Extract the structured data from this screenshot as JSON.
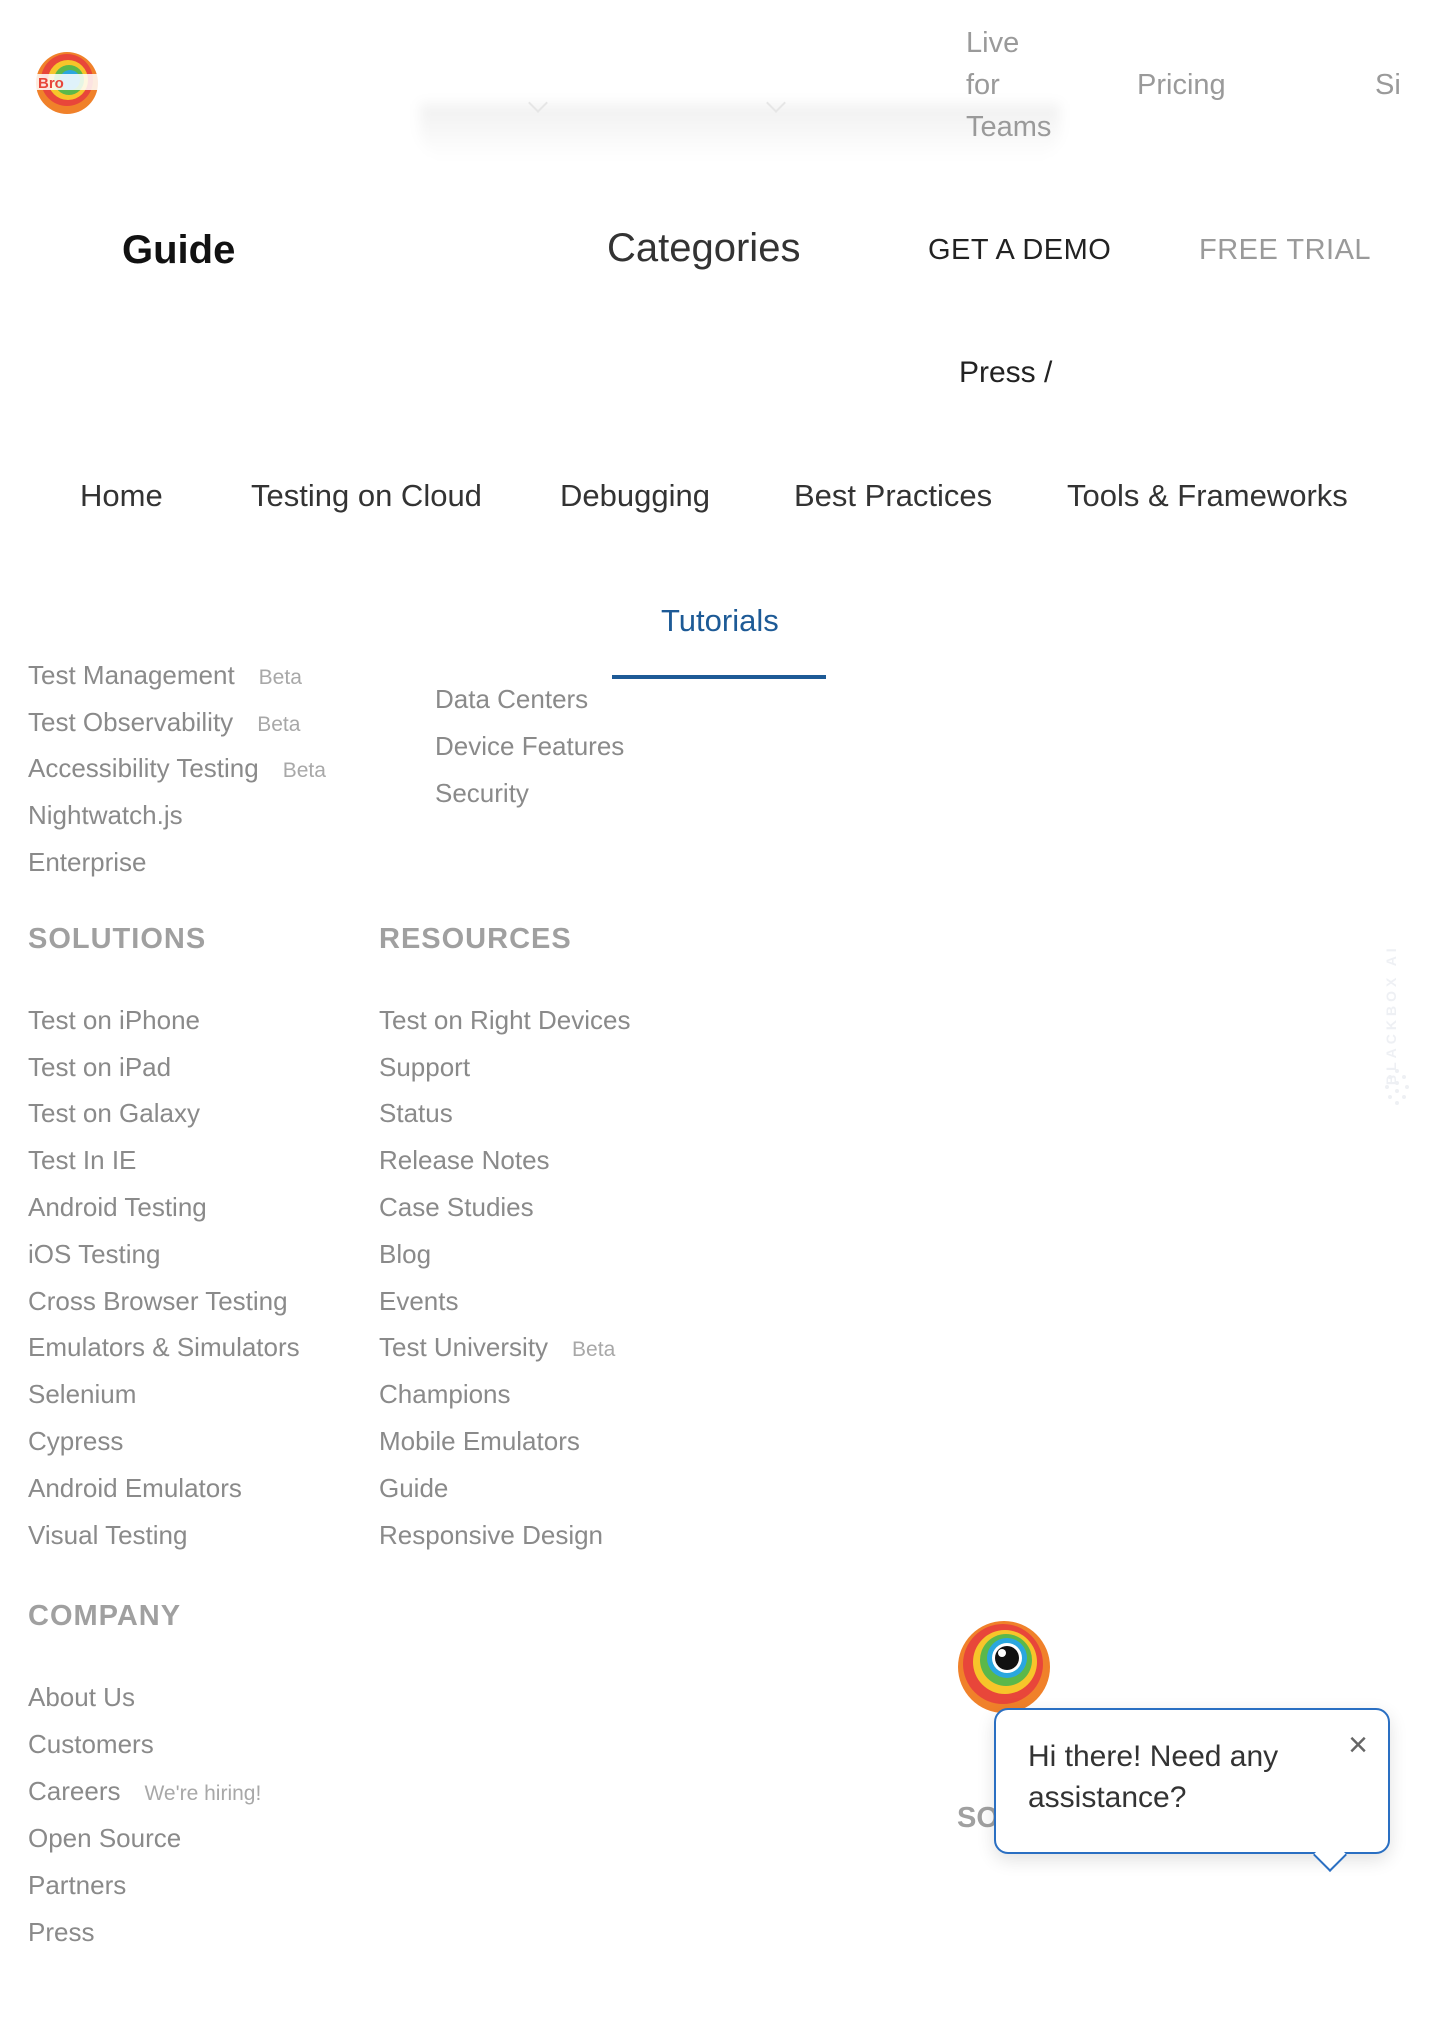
{
  "topbar": {
    "live_for_teams": [
      "Live",
      "for",
      "Teams"
    ],
    "pricing": "Pricing",
    "signin_partial": "Si"
  },
  "header": {
    "guide_title": "Guide",
    "categories": "Categories",
    "get_demo": "GET A DEMO",
    "free_trial": "FREE TRIAL",
    "press": "Press /"
  },
  "nav": {
    "items": [
      "Home",
      "Testing on Cloud",
      "Debugging",
      "Best Practices",
      "Tools & Frameworks"
    ],
    "active_tab": "Tutorials"
  },
  "products": {
    "col1": [
      {
        "label": "Test Management",
        "badge": "Beta"
      },
      {
        "label": "Test Observability",
        "badge": "Beta"
      },
      {
        "label": "Accessibility Testing",
        "badge": "Beta"
      },
      {
        "label": "Nightwatch.js",
        "badge": ""
      },
      {
        "label": "Enterprise",
        "badge": ""
      }
    ],
    "col2": [
      "Data Centers",
      "Device Features",
      "Security"
    ]
  },
  "solutions": {
    "heading": "SOLUTIONS",
    "items": [
      "Test on iPhone",
      "Test on iPad",
      "Test on Galaxy",
      "Test In IE",
      "Android Testing",
      "iOS Testing",
      "Cross Browser Testing",
      "Emulators & Simulators",
      "Selenium",
      "Cypress",
      "Android Emulators",
      "Visual Testing"
    ]
  },
  "resources": {
    "heading": "RESOURCES",
    "items": [
      {
        "label": "Test on Right Devices",
        "badge": ""
      },
      {
        "label": "Support",
        "badge": ""
      },
      {
        "label": "Status",
        "badge": ""
      },
      {
        "label": "Release Notes",
        "badge": ""
      },
      {
        "label": "Case Studies",
        "badge": ""
      },
      {
        "label": "Blog",
        "badge": ""
      },
      {
        "label": "Events",
        "badge": ""
      },
      {
        "label": "Test University",
        "badge": "Beta"
      },
      {
        "label": "Champions",
        "badge": ""
      },
      {
        "label": "Mobile Emulators",
        "badge": ""
      },
      {
        "label": "Guide",
        "badge": ""
      },
      {
        "label": "Responsive Design",
        "badge": ""
      }
    ]
  },
  "company": {
    "heading": "COMPANY",
    "items": [
      {
        "label": "About Us",
        "badge": ""
      },
      {
        "label": "Customers",
        "badge": ""
      },
      {
        "label": "Careers",
        "badge": "We're hiring!"
      },
      {
        "label": "Open Source",
        "badge": ""
      },
      {
        "label": "Partners",
        "badge": ""
      },
      {
        "label": "Press",
        "badge": ""
      }
    ]
  },
  "watermark": "BLACKBOX AI",
  "chat": {
    "message": "Hi there! Need any assistance?",
    "close": "×",
    "behind_heading_partial": "SO"
  },
  "colors": {
    "accent": "#1d5a96",
    "chat_border": "#2a6fc2"
  }
}
